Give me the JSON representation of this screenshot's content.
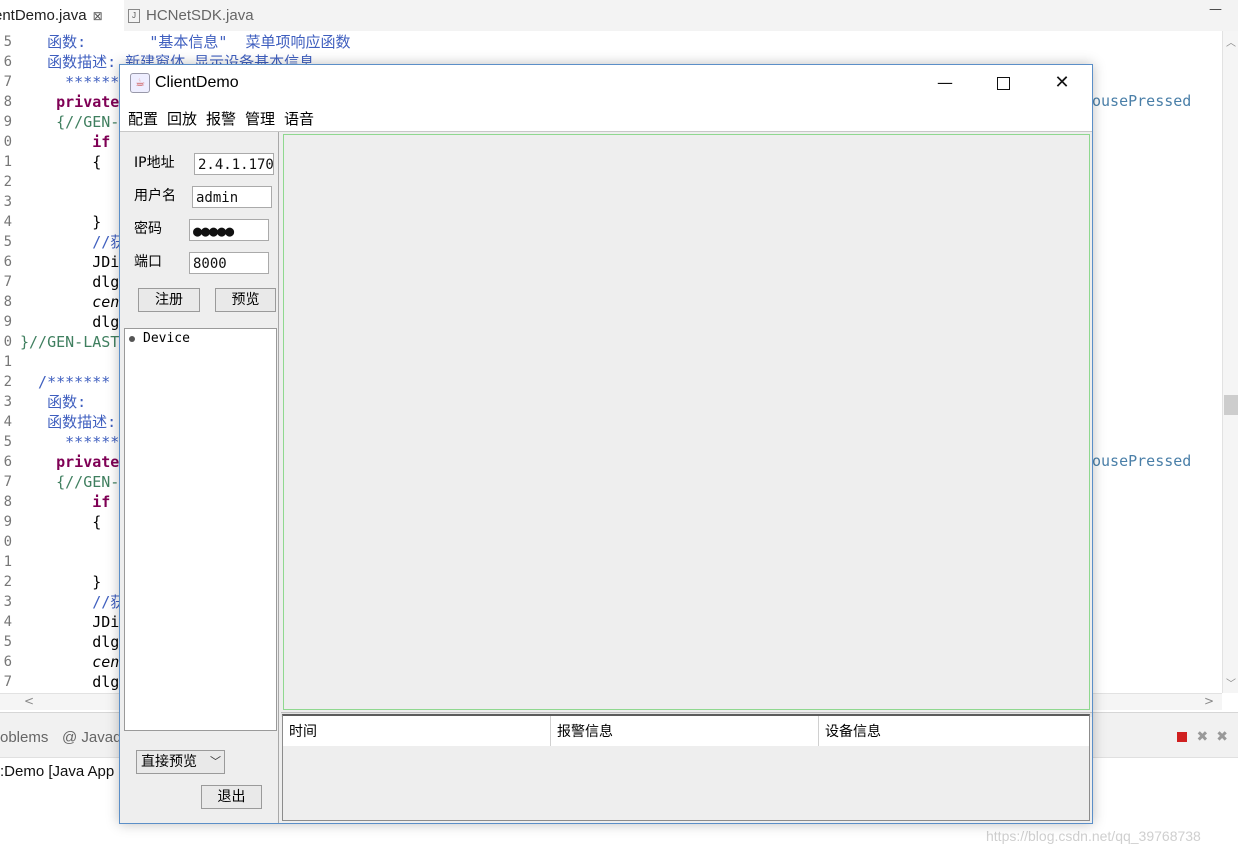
{
  "editor": {
    "tab_active": "entDemo.java",
    "tab_close": "⊠",
    "tab_inactive": "HCNetSDK.java",
    "lines": [
      {
        "num": "5",
        "text": "   函数:       \"基本信息\"  菜单项响应函数"
      },
      {
        "num": "6",
        "text": "   函数描述: 新建窗体 显示设备基本信息"
      },
      {
        "num": "7",
        "text": "     ******"
      },
      {
        "num": "8",
        "text": "    private"
      },
      {
        "num": "9",
        "text": "    {//GEN-"
      },
      {
        "num": "0",
        "text": "        if"
      },
      {
        "num": "1",
        "text": "        {"
      },
      {
        "num": "2",
        "text": ""
      },
      {
        "num": "3",
        "text": ""
      },
      {
        "num": "4",
        "text": "        }"
      },
      {
        "num": "5",
        "text": "        //获"
      },
      {
        "num": "6",
        "text": "        JDi"
      },
      {
        "num": "7",
        "text": "        dlg"
      },
      {
        "num": "8",
        "text": "        cen"
      },
      {
        "num": "9",
        "text": "        dlg"
      },
      {
        "num": "0",
        "text": "}//GEN-LAST"
      },
      {
        "num": "1",
        "text": ""
      },
      {
        "num": "2",
        "text": "  /*******"
      },
      {
        "num": "3",
        "text": "   函数:"
      },
      {
        "num": "4",
        "text": "   函数描述:"
      },
      {
        "num": "5",
        "text": "     ******"
      },
      {
        "num": "6",
        "text": "    private"
      },
      {
        "num": "7",
        "text": "    {//GEN-"
      },
      {
        "num": "8",
        "text": "        if"
      },
      {
        "num": "9",
        "text": "        {"
      },
      {
        "num": "0",
        "text": ""
      },
      {
        "num": "1",
        "text": ""
      },
      {
        "num": "2",
        "text": "        }"
      },
      {
        "num": "3",
        "text": "        //获"
      },
      {
        "num": "4",
        "text": "        JDi"
      },
      {
        "num": "5",
        "text": "        dlg"
      },
      {
        "num": "6",
        "text": "        cen"
      },
      {
        "num": "7",
        "text": "        dlg"
      }
    ],
    "right_text_1": "ousePressed",
    "right_text_2": "ousePressed"
  },
  "bottom_panel": {
    "tab_problems": "oblems",
    "tab_javadoc": "@ Javad",
    "console_title": ":Demo [Java App"
  },
  "watermark": "https://blog.csdn.net/qq_39768738",
  "window": {
    "title": "ClientDemo",
    "min": "—",
    "close": "✕",
    "menus": [
      "配置",
      "回放",
      "报警",
      "管理",
      "语音"
    ],
    "login": {
      "ip_label": "IP地址",
      "ip_value": "2.4.1.170",
      "user_label": "用户名",
      "user_value": "admin",
      "pwd_label": "密码",
      "pwd_value": "●●●●●",
      "port_label": "端口",
      "port_value": "8000",
      "register_btn": "注册",
      "preview_btn": "预览"
    },
    "tree": {
      "root": "Device"
    },
    "combo": {
      "selected": "直接预览",
      "arrow": "﹀"
    },
    "exit_btn": "退出",
    "alarm_table": {
      "columns": [
        "时间",
        "报警信息",
        "设备信息"
      ]
    }
  }
}
